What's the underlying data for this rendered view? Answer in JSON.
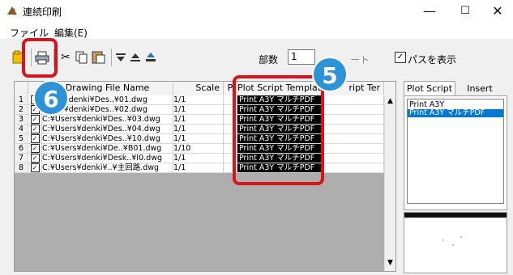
{
  "window": {
    "title": "連続印刷",
    "min_glyph": "—",
    "max_glyph": "☐",
    "close_glyph": "✕"
  },
  "menu": {
    "file": "ファイル",
    "edit": "編集(E)"
  },
  "toolbar": {
    "copies_label": "部数",
    "copies_value": "1",
    "sheet_label": "ート",
    "show_path_label": "パスを表示",
    "show_path_checked": true
  },
  "grid": {
    "headers": {
      "drawing_file": "Drawing File Name",
      "scale": "Scale",
      "p": "P",
      "plot_template": "Plot Script Template",
      "script_template": "ript Ter"
    },
    "rows": [
      {
        "num": "1",
        "file": "Users¥denki¥Des..¥01.dwg",
        "scale": "1/1",
        "template": "Print A3Y マルチPDF"
      },
      {
        "num": "2",
        "file": "Users¥denki¥Des..¥02.dwg",
        "scale": "1/1",
        "template": "Print A3Y マルチPDF"
      },
      {
        "num": "3",
        "file": "C:¥Users¥denki¥Des..¥03.dwg",
        "scale": "1/1",
        "template": "Print A3Y マルチPDF"
      },
      {
        "num": "4",
        "file": "C:¥Users¥denki¥Des..¥04.dwg",
        "scale": "1/1",
        "template": "Print A3Y マルチPDF"
      },
      {
        "num": "5",
        "file": "C:¥Users¥denki¥Des..¥10.dwg",
        "scale": "1/1",
        "template": "Print A3Y マルチPDF"
      },
      {
        "num": "6",
        "file": "C:¥Users¥denki¥De..¥B01.dwg",
        "scale": "1/10",
        "template": "Print A3Y マルチPDF"
      },
      {
        "num": "7",
        "file": "C:¥Users¥denki¥Desk..¥I0.dwg",
        "scale": "1/1",
        "template": "Print A3Y マルチPDF"
      },
      {
        "num": "8",
        "file": "C:¥Users¥denki¥..¥主回路.dwg",
        "scale": "1/1",
        "template": "Print A3Y マルチPDF"
      }
    ]
  },
  "side_panel": {
    "tab_plot": "Plot Script",
    "tab_insert": "Insert Script",
    "items": [
      "Print A3Y",
      "Print A3Y マルチPDF"
    ],
    "selected_index": 1
  },
  "callouts": {
    "badge_a": "6",
    "badge_b": "5"
  },
  "colors": {
    "callout_blue": "#2e93d6",
    "callout_red": "#d8141b",
    "selection": "#0078d7"
  },
  "icons": [
    "app-icon",
    "open-folder-icon",
    "print-icon",
    "cut-icon",
    "copy-icon",
    "paste-icon",
    "move-down-icon",
    "move-up-icon",
    "eject-icon"
  ]
}
